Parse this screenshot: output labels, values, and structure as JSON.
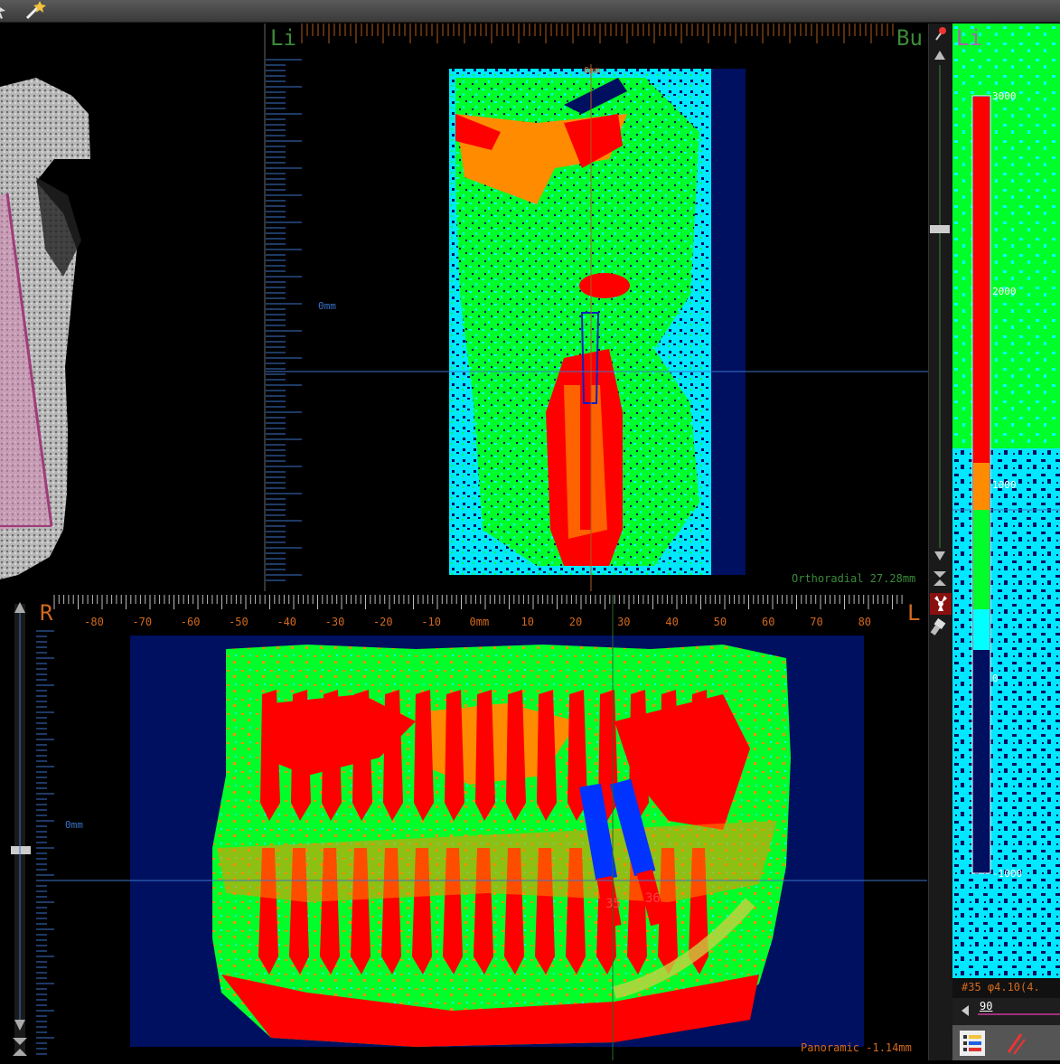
{
  "ortho": {
    "label_left": "Li",
    "label_right": "Bu",
    "top_mm": "0mm",
    "center_mm": "0mm",
    "status": "Orthoradial 27.28mm"
  },
  "pano": {
    "label_left": "R",
    "label_right": "L",
    "ticks": [
      "-80",
      "-70",
      "-60",
      "-50",
      "-40",
      "-30",
      "-20",
      "-10",
      "0mm",
      "10",
      "20",
      "30",
      "40",
      "50",
      "60",
      "70",
      "80"
    ],
    "center_mm": "0mm",
    "status": "Panoramic -1.14mm",
    "implants": [
      "35",
      "36"
    ]
  },
  "right": {
    "label": "Li",
    "scale": [
      "3000",
      "2000",
      "1000",
      "0",
      "-1000"
    ],
    "info": "#35 φ4.10(4.",
    "slider_value": "90"
  },
  "icons": {
    "toolbar": [
      "cursor-icon",
      "magic-wand-icon"
    ],
    "strip": [
      "pin-icon",
      "arrow-up-icon",
      "arrow-down-icon",
      "fit-icon",
      "radiation-icon",
      "flashlight-icon"
    ],
    "tools": [
      "layers-icon",
      "pen-icon"
    ]
  }
}
